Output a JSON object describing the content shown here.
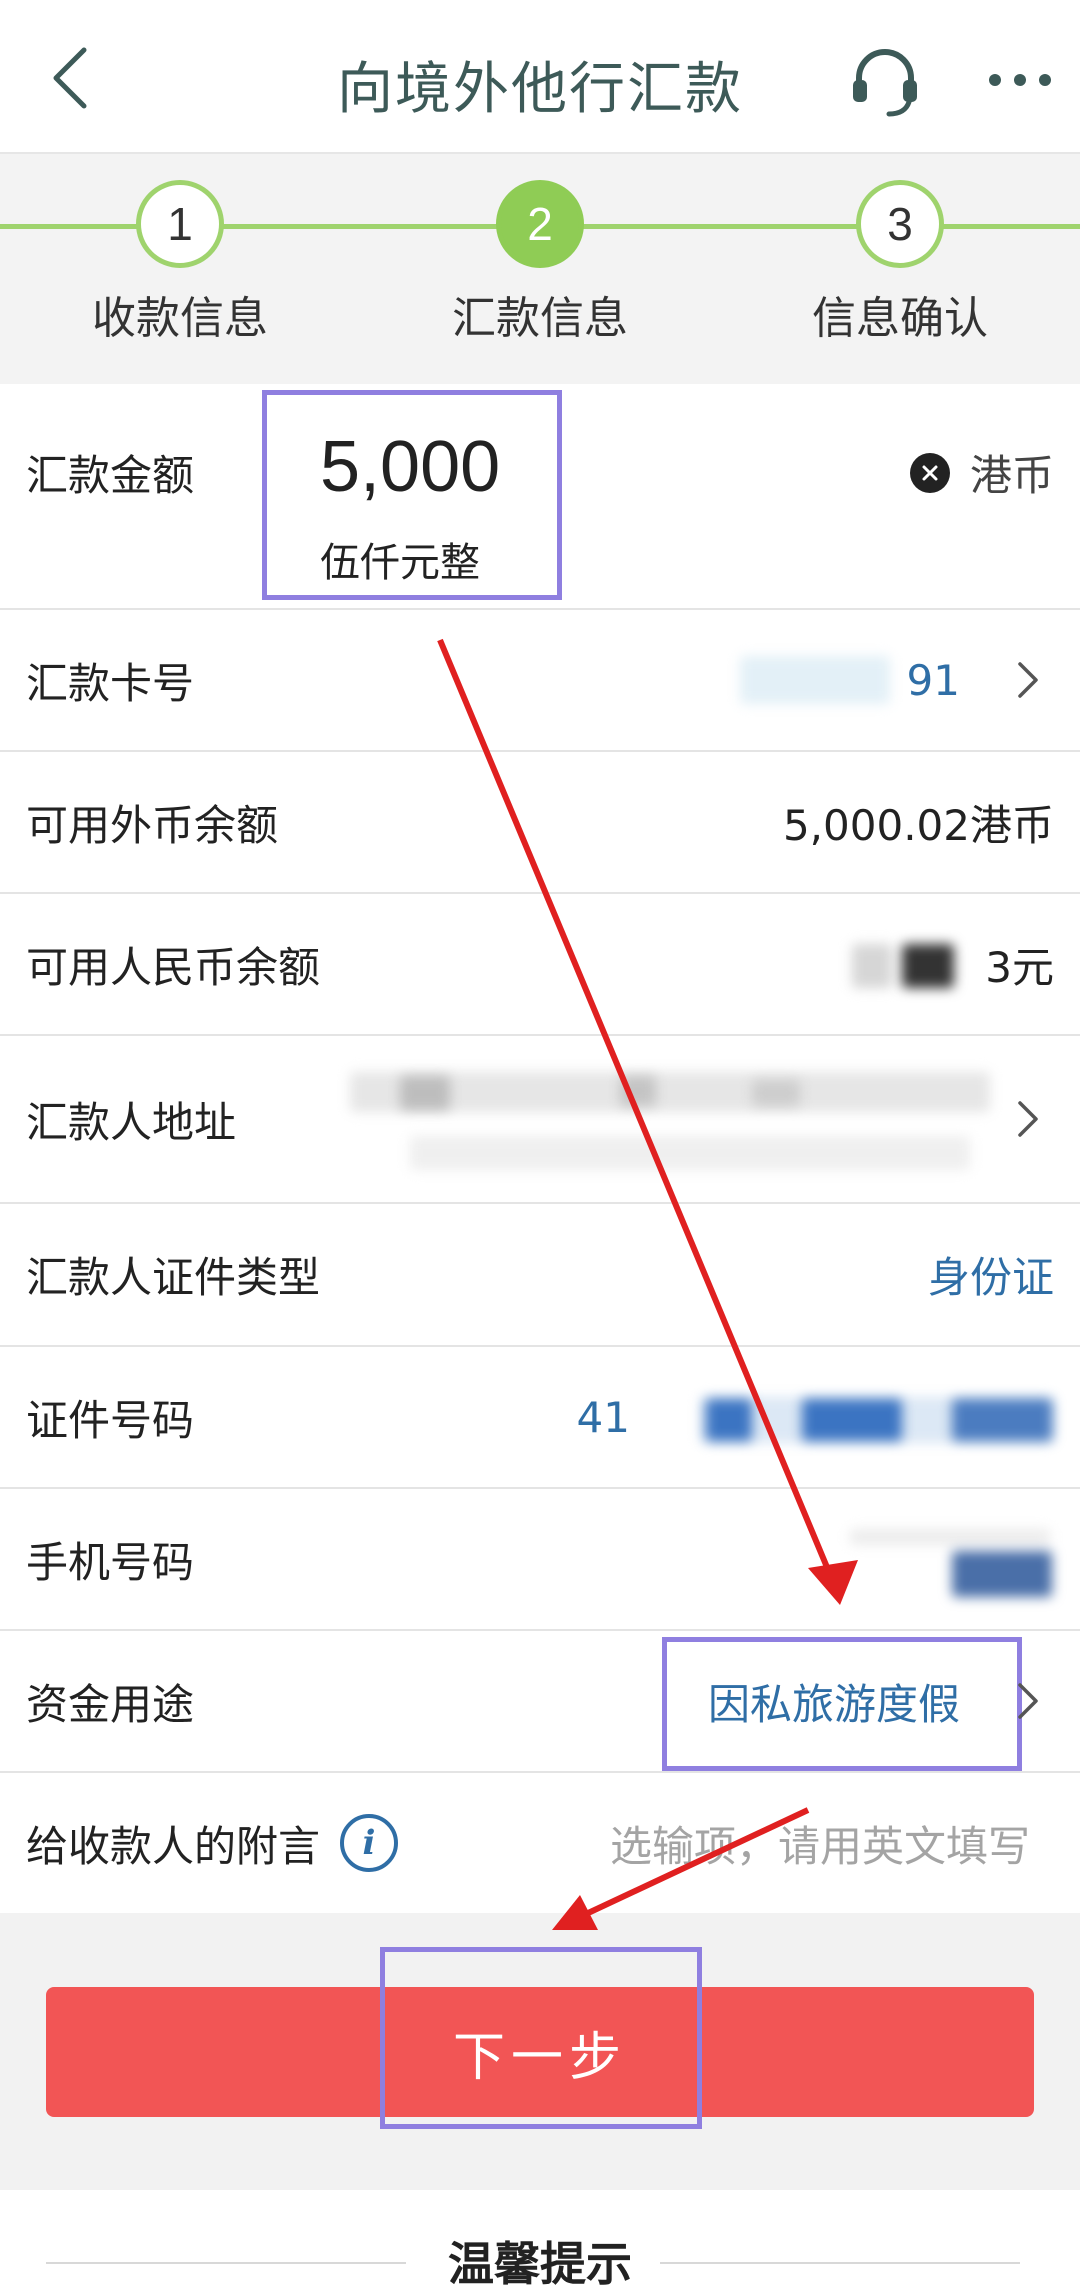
{
  "header": {
    "title": "向境外他行汇款",
    "back_icon": "chevron-left-icon",
    "service_icon": "headset-icon",
    "more_icon": "more-dots-icon"
  },
  "steps": [
    {
      "number": "1",
      "label": "收款信息",
      "state": "done"
    },
    {
      "number": "2",
      "label": "汇款信息",
      "state": "active"
    },
    {
      "number": "3",
      "label": "信息确认",
      "state": "todo"
    }
  ],
  "form": {
    "amount": {
      "label": "汇款金额",
      "value": "5,000",
      "in_words": "伍仟元整",
      "currency": "港币"
    },
    "card": {
      "label": "汇款卡号",
      "value": "91"
    },
    "fx_balance": {
      "label": "可用外币余额",
      "value": "5,000.02港币"
    },
    "rmb_balance": {
      "label": "可用人民币余额",
      "value": "3元"
    },
    "address": {
      "label": "汇款人地址"
    },
    "id_type": {
      "label": "汇款人证件类型",
      "value": "身份证"
    },
    "id_number": {
      "label": "证件号码",
      "value": "41"
    },
    "phone": {
      "label": "手机号码"
    },
    "purpose": {
      "label": "资金用途",
      "value": "因私旅游度假"
    },
    "remark": {
      "label": "给收款人的附言",
      "placeholder": "选输项，请用英文填写"
    }
  },
  "actions": {
    "next_label": "下一步"
  },
  "tips": {
    "title": "温馨提示"
  },
  "colors": {
    "accent_green": "#8fcc55",
    "link_blue": "#2f6ea6",
    "button_red": "#f25555",
    "highlight_purple": "#8f7fe0",
    "arrow_red": "#e02020"
  }
}
